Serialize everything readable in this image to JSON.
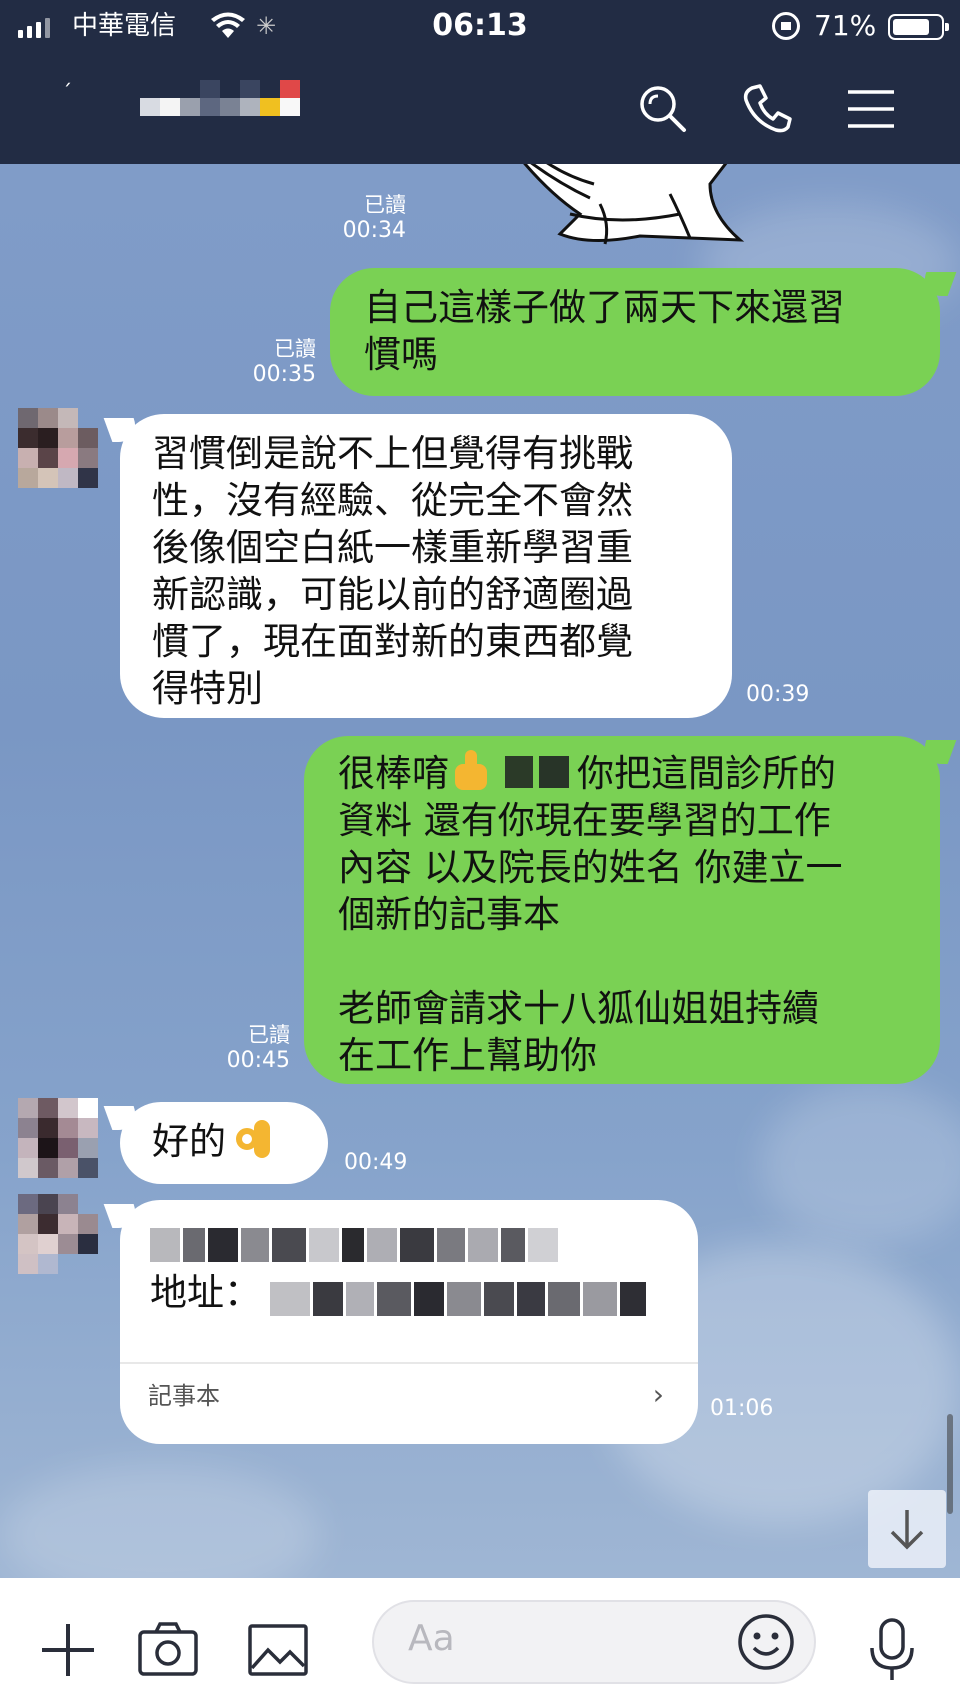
{
  "status_bar": {
    "carrier": "中華電信",
    "time": "06:13",
    "battery": "71%"
  },
  "header": {
    "icons": [
      "search-icon",
      "phone-icon",
      "menu-icon"
    ]
  },
  "messages": [
    {
      "id": "sticker",
      "direction": "out",
      "read": "已讀",
      "time": "00:34"
    },
    {
      "id": "m1",
      "direction": "out",
      "text": "自己這樣子做了兩天下來還習\n慣嗎",
      "read": "已讀",
      "time": "00:35"
    },
    {
      "id": "m2",
      "direction": "in",
      "text": "習慣倒是說不上但覺得有挑戰\n性，沒有經驗、從完全不會然\n後像個空白紙一樣重新學習重\n新認識，可能以前的舒適圈過\n慣了，現在面對新的東西都覺\n得特別",
      "time": "00:39"
    },
    {
      "id": "m3",
      "direction": "out",
      "text_line1_prefix": "很棒唷",
      "text_line1_suffix": "你把這間診所的",
      "text_rest": "資料 還有你現在要學習的工作\n內容 以及院長的姓名 你建立一\n個新的記事本\n\n老師會請求十八狐仙姐姐持續\n在工作上幫助你",
      "read": "已讀",
      "time": "00:45"
    },
    {
      "id": "m4",
      "direction": "in",
      "text": "好的",
      "time": "00:49"
    },
    {
      "id": "m5",
      "direction": "in",
      "address_label": "地址：",
      "note_link": "記事本",
      "time": "01:06"
    }
  ],
  "input": {
    "placeholder": "Aa"
  },
  "bottom_icons": [
    "plus-icon",
    "camera-icon",
    "image-icon",
    "smile-icon",
    "mic-icon"
  ],
  "colors": {
    "header_bg": "#222c44",
    "chat_bg": "#7d9bc6",
    "outgoing_bubble": "#7ad154",
    "incoming_bubble": "#ffffff"
  }
}
